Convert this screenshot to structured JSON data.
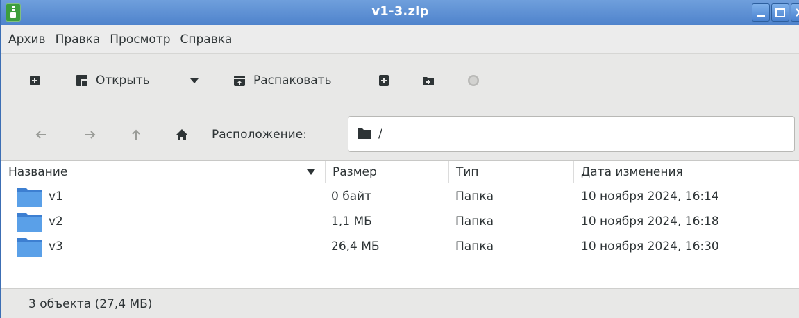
{
  "window": {
    "title": "v1-3.zip"
  },
  "menu": {
    "items": [
      "Архив",
      "Правка",
      "Просмотр",
      "Справка"
    ]
  },
  "toolbar": {
    "open_label": "Открыть",
    "extract_label": "Распаковать",
    "icons": [
      "new-archive-icon",
      "open-icon",
      "dropdown-arrow-icon",
      "extract-icon",
      "add-file-icon",
      "add-folder-icon",
      "stop-icon"
    ]
  },
  "location": {
    "label": "Расположение:",
    "path": "/"
  },
  "columns": [
    "Название",
    "Размер",
    "Тип",
    "Дата изменения"
  ],
  "files": [
    {
      "name": "v1",
      "size": "0 байт",
      "type": "Папка",
      "modified": "10 ноября 2024, 16:14"
    },
    {
      "name": "v2",
      "size": "1,1 МБ",
      "type": "Папка",
      "modified": "10 ноября 2024, 16:18"
    },
    {
      "name": "v3",
      "size": "26,4 МБ",
      "type": "Папка",
      "modified": "10 ноября 2024, 16:30"
    }
  ],
  "status": {
    "text": "3 объекта (27,4 МБ)"
  },
  "colors": {
    "titlebar": "#5a8fd6",
    "folder": "#4a90d9",
    "toolbar_bg": "#e8e8e7"
  }
}
